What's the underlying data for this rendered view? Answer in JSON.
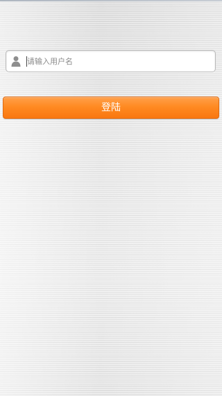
{
  "login_form": {
    "username_placeholder": "请输入用户名",
    "username_value": "",
    "user_icon": "user-icon",
    "login_button_label": "登陆"
  },
  "colors": {
    "accent": "#ff8a22",
    "button_text": "#ffffff",
    "input_background": "#ffffff",
    "background": "#e4e4e4"
  }
}
